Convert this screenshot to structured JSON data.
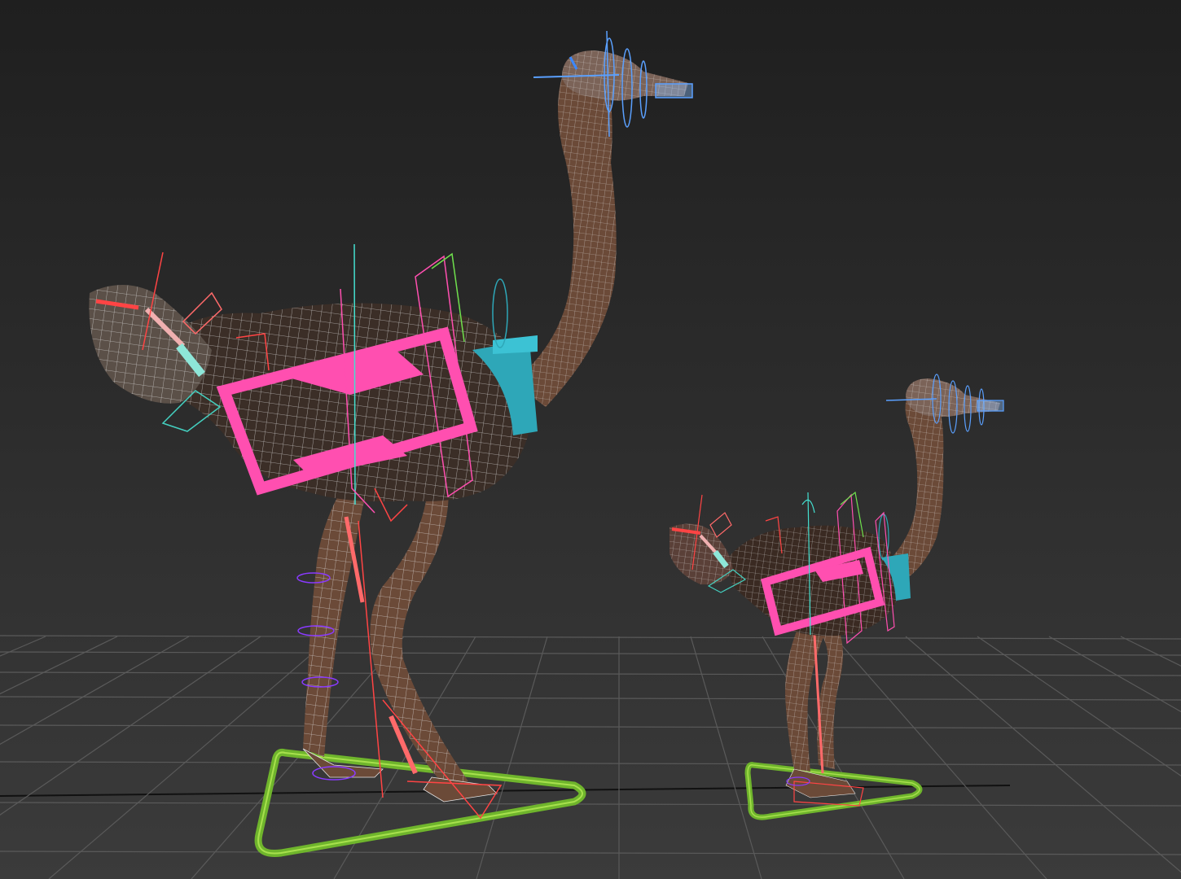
{
  "viewport": {
    "kind": "3d-perspective-viewport",
    "background_top": "#1f1f1f",
    "background_bottom": "#3a3a3a",
    "grid_color": "#5a5a5a",
    "grid_axis_color": "#111111"
  },
  "scene": {
    "objects": [
      {
        "id": "adult-ostrich",
        "icon": "ostrich-mesh",
        "mesh_color": "#3b2e27",
        "neck_color": "#6b4a38",
        "wireframe_color": "#e6e6e6",
        "controls": {
          "root": "#6fb52c",
          "spine": "#ff4fb0",
          "chest": "#2ea7b8",
          "head": "#5aa0ff",
          "tail": "#ff4444",
          "legs": "#8a3aff"
        }
      },
      {
        "id": "juvenile-ostrich",
        "icon": "ostrich-mesh",
        "mesh_color": "#3a2a22",
        "neck_color": "#6b4a38",
        "wireframe_color": "#e6e6e6",
        "controls": {
          "root": "#6fb52c",
          "spine": "#ff4fb0",
          "chest": "#2ea7b8",
          "head": "#5aa0ff",
          "tail": "#ff4444",
          "legs": "#8a3aff"
        }
      }
    ]
  }
}
